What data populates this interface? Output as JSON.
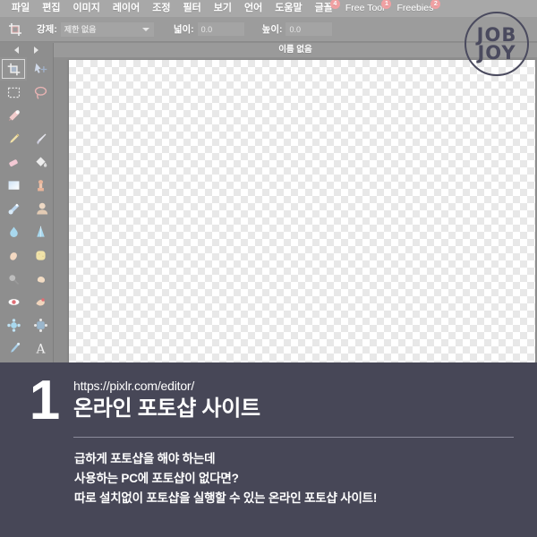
{
  "menubar": {
    "items": [
      {
        "label": "파일",
        "badge": null,
        "latin": false
      },
      {
        "label": "편집",
        "badge": null,
        "latin": false
      },
      {
        "label": "이미지",
        "badge": null,
        "latin": false
      },
      {
        "label": "레이어",
        "badge": null,
        "latin": false
      },
      {
        "label": "조정",
        "badge": null,
        "latin": false
      },
      {
        "label": "필터",
        "badge": null,
        "latin": false
      },
      {
        "label": "보기",
        "badge": null,
        "latin": false
      },
      {
        "label": "언어",
        "badge": null,
        "latin": false
      },
      {
        "label": "도움말",
        "badge": null,
        "latin": false
      },
      {
        "label": "글꼴",
        "badge": "4",
        "latin": false
      },
      {
        "label": "Free Tool",
        "badge": "1",
        "latin": true
      },
      {
        "label": "Freebies",
        "badge": "2",
        "latin": true
      }
    ]
  },
  "optionbar": {
    "tool_icon": "crop-icon",
    "constraint_label": "강제:",
    "constraint_value": "제한 없음",
    "width_label": "넓이:",
    "width_value": "0.0",
    "height_label": "높이:",
    "height_value": "0.0"
  },
  "toolpalette": {
    "nav_prev": "prev-tools-arrow",
    "nav_next": "next-tools-arrow",
    "tools": [
      {
        "name": "crop-tool",
        "icon": "crop-icon",
        "selected": true
      },
      {
        "name": "move-tool",
        "icon": "move-arrow-icon",
        "selected": false
      },
      {
        "name": "marquee-select-tool",
        "icon": "marquee-select-icon",
        "selected": false
      },
      {
        "name": "lasso-tool",
        "icon": "lasso-icon",
        "selected": false
      },
      {
        "name": "magic-wand-tool",
        "icon": "magic-wand-icon",
        "selected": false
      },
      {
        "name": "spacer-tool",
        "icon": "blank-icon",
        "selected": false
      },
      {
        "name": "pencil-tool",
        "icon": "pencil-icon",
        "selected": false
      },
      {
        "name": "brush-tool",
        "icon": "brush-icon",
        "selected": false
      },
      {
        "name": "eraser-tool",
        "icon": "eraser-icon",
        "selected": false
      },
      {
        "name": "paint-bucket-tool",
        "icon": "paint-bucket-icon",
        "selected": false
      },
      {
        "name": "gradient-tool",
        "icon": "gradient-icon",
        "selected": false
      },
      {
        "name": "clone-stamp-tool",
        "icon": "clone-stamp-icon",
        "selected": false
      },
      {
        "name": "color-replace-tool",
        "icon": "color-replace-icon",
        "selected": false
      },
      {
        "name": "drawing-tool",
        "icon": "drawing-icon",
        "selected": false
      },
      {
        "name": "blur-tool",
        "icon": "water-drop-icon",
        "selected": false
      },
      {
        "name": "sharpen-tool",
        "icon": "sharpen-cone-icon",
        "selected": false
      },
      {
        "name": "smudge-tool",
        "icon": "finger-smudge-icon",
        "selected": false
      },
      {
        "name": "sponge-tool",
        "icon": "sponge-icon",
        "selected": false
      },
      {
        "name": "dodge-tool",
        "icon": "dodge-icon",
        "selected": false
      },
      {
        "name": "burn-tool",
        "icon": "burn-hand-icon",
        "selected": false
      },
      {
        "name": "red-eye-tool",
        "icon": "red-eye-icon",
        "selected": false
      },
      {
        "name": "spot-heal-tool",
        "icon": "spot-heal-icon",
        "selected": false
      },
      {
        "name": "bloat-tool",
        "icon": "bloat-icon",
        "selected": false
      },
      {
        "name": "pinch-tool",
        "icon": "pinch-icon",
        "selected": false
      },
      {
        "name": "eyedropper-tool",
        "icon": "eyedropper-icon",
        "selected": false
      },
      {
        "name": "type-tool",
        "icon": "text-a-icon",
        "selected": false
      },
      {
        "name": "hand-tool",
        "icon": "hand-icon",
        "selected": false
      },
      {
        "name": "zoom-tool",
        "icon": "magnifier-icon",
        "selected": false
      }
    ]
  },
  "canvas": {
    "title": "이름 없음",
    "background": "transparent-checkerboard"
  },
  "logo": {
    "line1": "JOB",
    "line2": "JOY",
    "color": "#4a4a5e"
  },
  "panel": {
    "number": "1",
    "url": "https://pixlr.com/editor/",
    "title": "온라인 포토샵 사이트",
    "body_lines": [
      "급하게 포토샵을 해야 하는데",
      "사용하는 PC에 포토샵이 없다면?",
      "따로 설치없이 포토샵을 실행할 수 있는 온라인 포토샵 사이트!"
    ],
    "background_color": "#474757",
    "text_color": "#ffffff"
  }
}
